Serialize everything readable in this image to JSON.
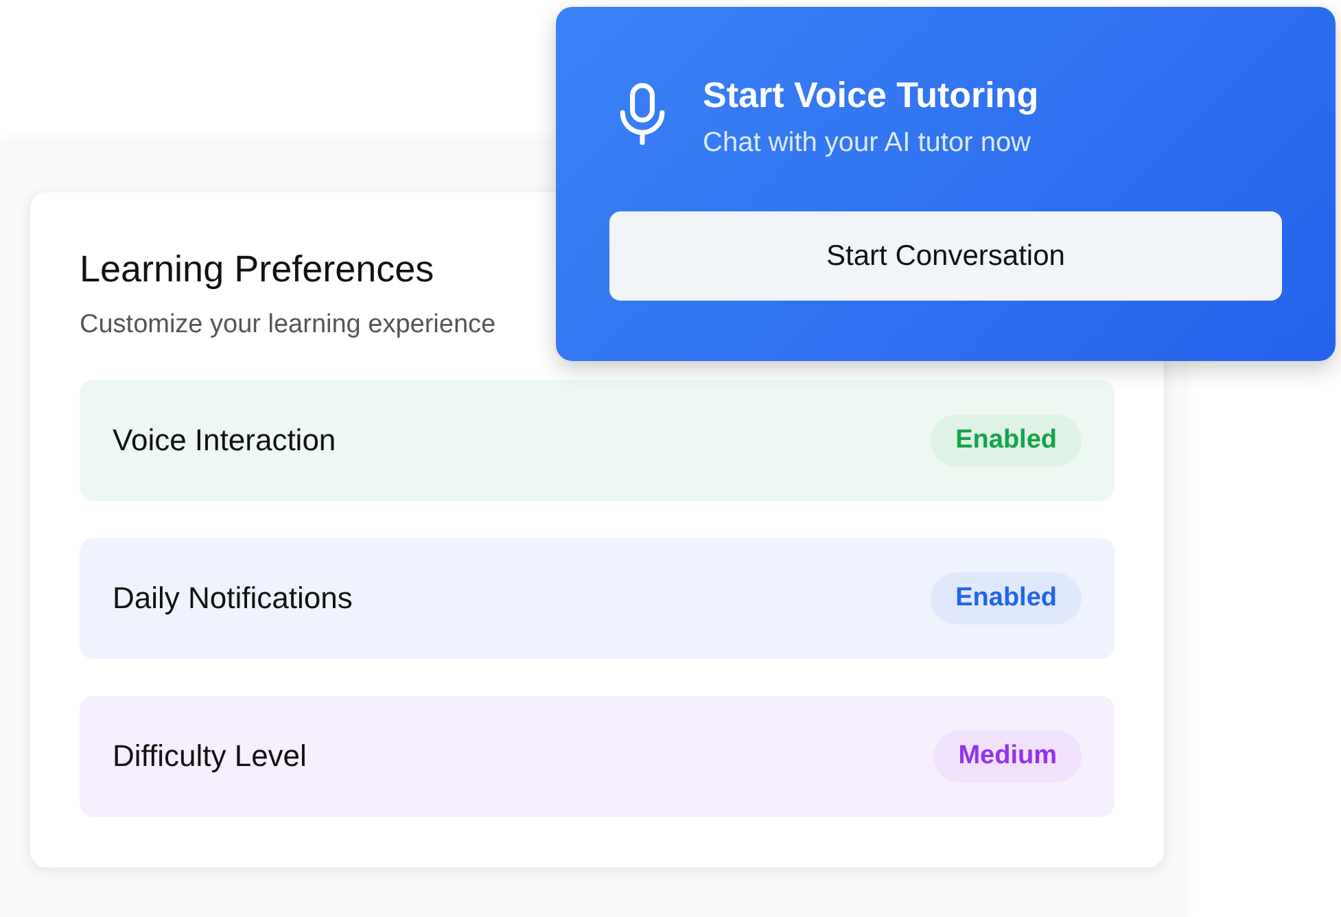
{
  "voice_card": {
    "title": "Start Voice Tutoring",
    "subtitle": "Chat with your AI tutor now",
    "button": "Start Conversation"
  },
  "preferences": {
    "title": "Learning Preferences",
    "subtitle": "Customize your learning experience",
    "items": [
      {
        "label": "Voice Interaction",
        "status": "Enabled",
        "color": "#16a34a"
      },
      {
        "label": "Daily Notifications",
        "status": "Enabled",
        "color": "#2563eb"
      },
      {
        "label": "Difficulty Level",
        "status": "Medium",
        "color": "#9333ea"
      }
    ]
  }
}
